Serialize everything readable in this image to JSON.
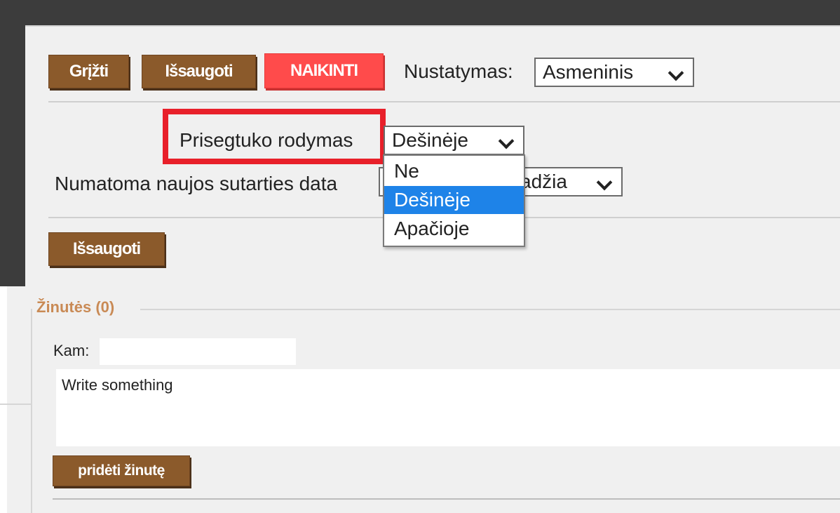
{
  "toolbar": {
    "back_label": "Grįžti",
    "save_label": "Išsaugoti",
    "delete_label": "NAIKINTI",
    "settings_label": "Nustatymas:",
    "settings_value": "Asmeninis"
  },
  "form": {
    "attachment_display_label": "Prisegtuko rodymas",
    "attachment_display_value": "Dešinėje",
    "contract_date_label": "Numatoma naujos sutarties data",
    "contract_date_value": "adžia",
    "save_label": "Išsaugoti"
  },
  "dropdown": {
    "options": [
      "Ne",
      "Dešinėje",
      "Apačioje"
    ],
    "selected_index": 1
  },
  "messages": {
    "legend": "Žinutės (0)",
    "to_label": "Kam:",
    "to_value": "",
    "message_placeholder": "Write something",
    "add_button_label": "pridėti žinutę"
  },
  "colors": {
    "button_brown": "#8b5a2b",
    "button_red": "#ff4b4b",
    "highlight_red": "#e8202a",
    "option_selected_blue": "#1e83e8",
    "legend_orange": "#c98a55"
  }
}
